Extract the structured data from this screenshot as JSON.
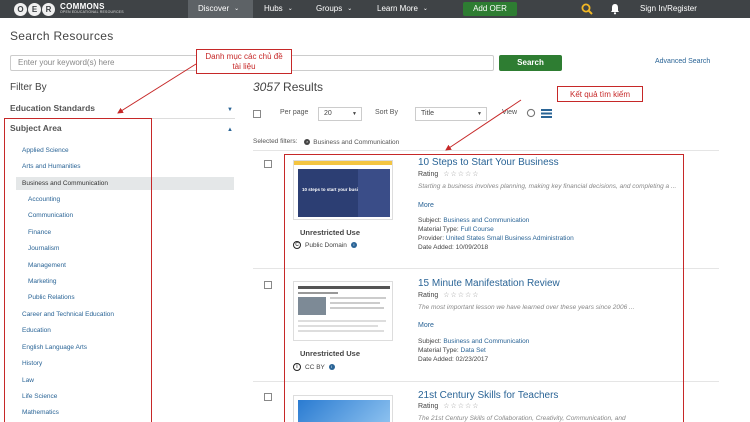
{
  "navbar": {
    "logo": {
      "letters": [
        "O",
        "E",
        "R"
      ],
      "main": "COMMONS",
      "sub": "OPEN EDUCATIONAL RESOURCES"
    },
    "items": [
      {
        "label": "Discover",
        "caret": "⌄"
      },
      {
        "label": "Hubs",
        "caret": "⌄"
      },
      {
        "label": "Groups",
        "caret": "⌄"
      },
      {
        "label": "Learn More",
        "caret": "⌄"
      }
    ],
    "add_label": "Add OER",
    "signin_label": "Sign In/Register",
    "accent_color": "#2e7d32",
    "bar_color": "#3f4346",
    "icons": [
      "search-icon",
      "bell-icon"
    ]
  },
  "search": {
    "title": "Search Resources",
    "placeholder": "Enter your keyword(s) here",
    "button_label": "Search",
    "advanced_label": "Advanced Search"
  },
  "filters": {
    "heading": "Filter By",
    "education_standards": "Education Standards",
    "subject_area": "Subject Area",
    "subjects": [
      "Applied Science",
      "Arts and Humanities",
      "Business and Communication",
      "Accounting",
      "Communication",
      "Finance",
      "Journalism",
      "Management",
      "Marketing",
      "Public Relations",
      "Career and Technical Education",
      "Education",
      "English Language Arts",
      "History",
      "Law",
      "Life Science",
      "Mathematics"
    ],
    "selected_subject": "Business and Communication"
  },
  "results": {
    "count": "3057",
    "count_label": "Results",
    "per_page_label": "Per page",
    "per_page_value": "20",
    "sort_label": "Sort By",
    "sort_value": "Title",
    "view_label": "View",
    "selected_filters_label": "Selected filters:",
    "selected_filter": "Business and Communication",
    "items": [
      {
        "title": "10 Steps to Start Your Business",
        "rating_label": "Rating",
        "stars": "☆☆☆☆☆",
        "description": "Starting a business involves planning, making key financial decisions, and completing a ...",
        "more": "More",
        "subject_label": "Subject:",
        "subject": "Business and Communication",
        "material_label": "Material Type:",
        "material": "Full Course",
        "provider_label": "Provider:",
        "provider": "United States Small Business Administration",
        "date_label": "Date Added:",
        "date": "10/09/2018",
        "rights": "Unrestricted Use",
        "license": "Public Domain",
        "thumb_text": "10 steps to start your business"
      },
      {
        "title": "15 Minute Manifestation Review",
        "rating_label": "Rating",
        "stars": "☆☆☆☆☆",
        "description": "The most important lesson we have learned over these years since 2006 ...",
        "more": "More",
        "subject_label": "Subject:",
        "subject": "Business and Communication",
        "material_label": "Material Type:",
        "material": "Data Set",
        "date_label": "Date Added:",
        "date": "02/23/2017",
        "rights": "Unrestricted Use",
        "license": "CC BY"
      },
      {
        "title": "21st Century Skills for Teachers",
        "rating_label": "Rating",
        "stars": "☆☆☆☆☆",
        "description": "The 21st Century Skills of Collaboration, Creativity, Communication, and"
      }
    ]
  },
  "annotations": {
    "left_callout": "Danh mục các chủ đề tài liệu",
    "right_callout": "Kết quả tìm kiếm",
    "color": "#c62828"
  }
}
